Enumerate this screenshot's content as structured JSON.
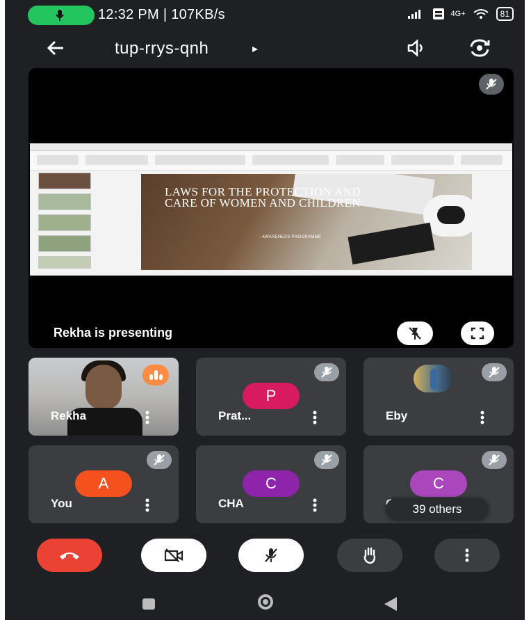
{
  "status_bar": {
    "time_speed": "12:32 PM | 107KB/s",
    "network": "4G+",
    "battery": "81"
  },
  "app_bar": {
    "meeting_code": "tup-rrys-qnh",
    "caret": "▸"
  },
  "stage": {
    "presenter_text": "Rekha is presenting",
    "slide": {
      "title": "LAWS FOR THE PROTECTION AND CARE OF WOMEN AND CHILDREN",
      "subtitle": "- AWARENESS PROGRAMME"
    }
  },
  "participants": [
    {
      "name": "Rekha",
      "type": "video",
      "speaking": true
    },
    {
      "name": "Prat...",
      "initial": "P",
      "color": "#d81b60",
      "muted": true
    },
    {
      "name": "Eby",
      "type": "photo",
      "muted": true
    },
    {
      "name": "You",
      "initial": "A",
      "color": "#f4511e",
      "muted": true
    },
    {
      "name": "CHA",
      "initial": "C",
      "color": "#8e24aa",
      "muted": true
    },
    {
      "name": "Ch",
      "initial": "C",
      "color": "#ab47bc",
      "muted": true
    }
  ],
  "others_label": "39 others",
  "controls": [
    "end-call",
    "camera-off",
    "mic-off",
    "raise-hand",
    "more-options"
  ],
  "colors": {
    "end_call": "#ea4335",
    "tile_bg": "#3c3d41",
    "speaking": "#fb8c44",
    "mic_pill": "#22c55e"
  }
}
